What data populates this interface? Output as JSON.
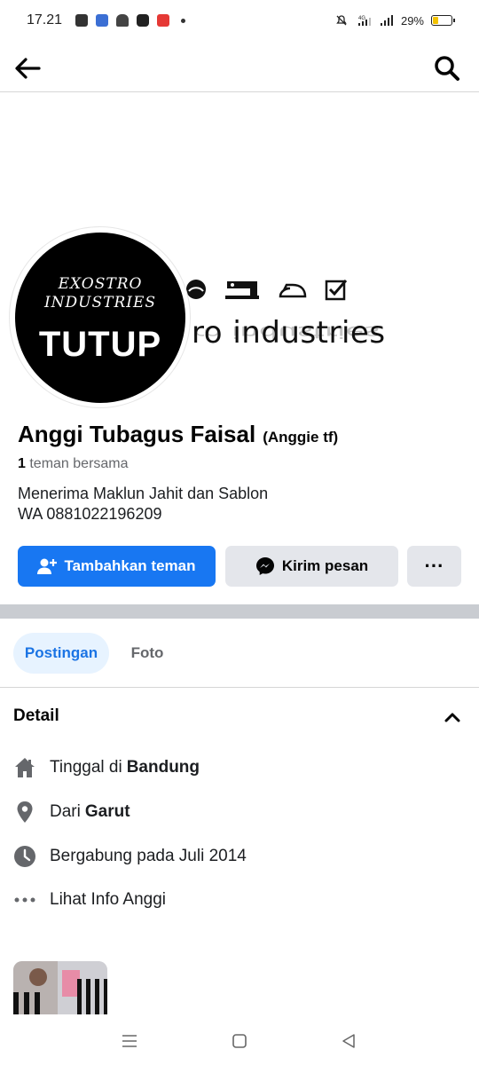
{
  "status_bar": {
    "time": "17.21",
    "battery": "29%",
    "battery_level": 0.29,
    "icons": [
      "shopee-icon",
      "app-icon",
      "android-icon",
      "youtube-icon",
      "app-icon-red",
      "dot-icon",
      "mute-icon",
      "signal-4g-icon",
      "signal-icon",
      "battery-icon"
    ]
  },
  "nav": {
    "back_icon": "arrow-left-icon",
    "search_icon": "search-icon"
  },
  "cover": {
    "text": "ro industries",
    "icons": [
      "helmet-icon",
      "sewing-machine-icon",
      "iron-icon",
      "checkbox-icon"
    ]
  },
  "avatar": {
    "brand_line1": "EXOSTRO",
    "brand_line2": "INDUSTRIES",
    "overlay": "TUTUP"
  },
  "profile": {
    "name": "Anggi Tubagus Faisal",
    "nickname": "(Anggie tf)",
    "mutual_count": "1",
    "mutual_text": "teman bersama",
    "bio_line1": "Menerima Maklun Jahit dan Sablon",
    "bio_line2": "WA 0881022196209"
  },
  "actions": {
    "add_friend": "Tambahkan teman",
    "message": "Kirim pesan",
    "more": "···"
  },
  "tabs": [
    {
      "label": "Postingan",
      "active": true
    },
    {
      "label": "Foto",
      "active": false
    }
  ],
  "detail": {
    "title": "Detail",
    "rows": [
      {
        "icon": "home-icon",
        "prefix": "Tinggal di",
        "value": "Bandung"
      },
      {
        "icon": "location-pin-icon",
        "prefix": "Dari",
        "value": "Garut"
      },
      {
        "icon": "clock-icon",
        "prefix": "Bergabung pada Juli 2014",
        "value": ""
      },
      {
        "icon": "more-dots-icon",
        "prefix": "Lihat Info Anggi",
        "value": ""
      }
    ]
  },
  "colors": {
    "accent": "#1877f2",
    "secondary_button": "#e4e6eb",
    "tab_active_bg": "#e7f3ff",
    "tab_active_text": "#1b74e4"
  }
}
